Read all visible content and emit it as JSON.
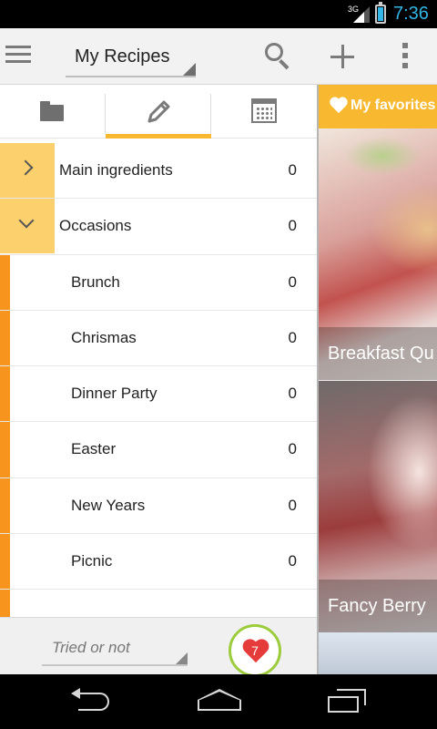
{
  "status_bar": {
    "network": "3G",
    "time": "7:36"
  },
  "action_bar": {
    "title": "My Recipes"
  },
  "tabs": [
    {
      "name": "folder-icon",
      "selected": false
    },
    {
      "name": "pencil-icon",
      "selected": true
    },
    {
      "name": "calendar-icon",
      "selected": false
    }
  ],
  "categories": [
    {
      "label": "Main ingredients",
      "count": "0",
      "expand": "collapsed"
    },
    {
      "label": "Occasions",
      "count": "0",
      "expand": "expanded"
    }
  ],
  "occasions": [
    {
      "label": "Brunch",
      "count": "0"
    },
    {
      "label": "Chrismas",
      "count": "0"
    },
    {
      "label": "Dinner Party",
      "count": "0"
    },
    {
      "label": "Easter",
      "count": "0"
    },
    {
      "label": "New Years",
      "count": "0"
    },
    {
      "label": "Picnic",
      "count": "0"
    }
  ],
  "filter": {
    "value": "Tried or not"
  },
  "favorites_badge": {
    "count": "7"
  },
  "favorites_panel": {
    "header": "My favorites",
    "cards": [
      {
        "caption": "Breakfast Qu"
      },
      {
        "caption": "Fancy Berry"
      }
    ]
  },
  "colors": {
    "accent": "#f8b930",
    "expander": "#fbd06d",
    "child_bar": "#f7941d",
    "heart": "#e53b3b",
    "badge_ring": "#9ccc3c",
    "status_time": "#33b5e5"
  }
}
